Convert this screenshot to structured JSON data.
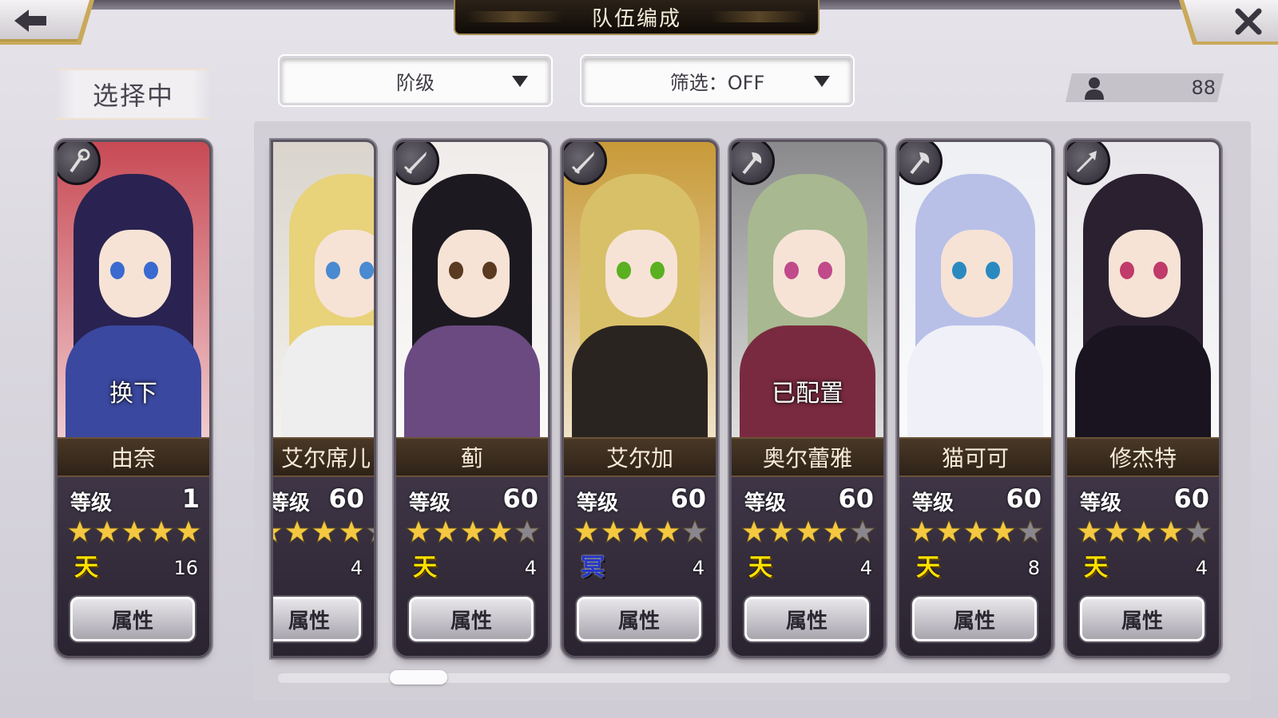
{
  "header": {
    "title": "队伍编成",
    "back_icon": "arrow-left-icon",
    "close_icon": "close-icon"
  },
  "selected": {
    "label": "选择中"
  },
  "filters": {
    "sort_label": "阶级",
    "filter_label": "筛选：OFF"
  },
  "unit_count": "88",
  "colors": {
    "title_bg": "#1a130c",
    "gold_border": "#c9a95a",
    "star_gold": "#f5c842",
    "star_grey": "#8a8690"
  },
  "cards": [
    {
      "name": "由奈",
      "level_label": "等级",
      "level": "1",
      "stars": 5,
      "max_stars": 5,
      "rarity": "天",
      "cost": "16",
      "overlay": "换下",
      "attr_label": "属性",
      "class_icon": "staff-icon"
    },
    {
      "name": "艾尔席儿",
      "level_label": "等级",
      "level": "60",
      "stars": 4,
      "max_stars": 5,
      "rarity": "",
      "cost": "4",
      "overlay": "",
      "attr_label": "属性",
      "class_icon": "sword-icon"
    },
    {
      "name": "蓟",
      "level_label": "等级",
      "level": "60",
      "stars": 4,
      "max_stars": 5,
      "rarity": "天",
      "cost": "4",
      "overlay": "",
      "attr_label": "属性",
      "class_icon": "sword-icon"
    },
    {
      "name": "艾尔加",
      "level_label": "等级",
      "level": "60",
      "stars": 4,
      "max_stars": 5,
      "rarity": "冥",
      "cost": "4",
      "overlay": "",
      "attr_label": "属性",
      "class_icon": "sword-icon"
    },
    {
      "name": "奥尔蕾雅",
      "level_label": "等级",
      "level": "60",
      "stars": 4,
      "max_stars": 5,
      "rarity": "天",
      "cost": "4",
      "overlay": "已配置",
      "attr_label": "属性",
      "class_icon": "axe-icon"
    },
    {
      "name": "猫可可",
      "level_label": "等级",
      "level": "60",
      "stars": 4,
      "max_stars": 5,
      "rarity": "天",
      "cost": "8",
      "overlay": "",
      "attr_label": "属性",
      "class_icon": "axe-icon"
    },
    {
      "name": "修杰特",
      "level_label": "等级",
      "level": "60",
      "stars": 4,
      "max_stars": 5,
      "rarity": "天",
      "cost": "4",
      "overlay": "",
      "attr_label": "属性",
      "class_icon": "arrow-icon"
    }
  ]
}
